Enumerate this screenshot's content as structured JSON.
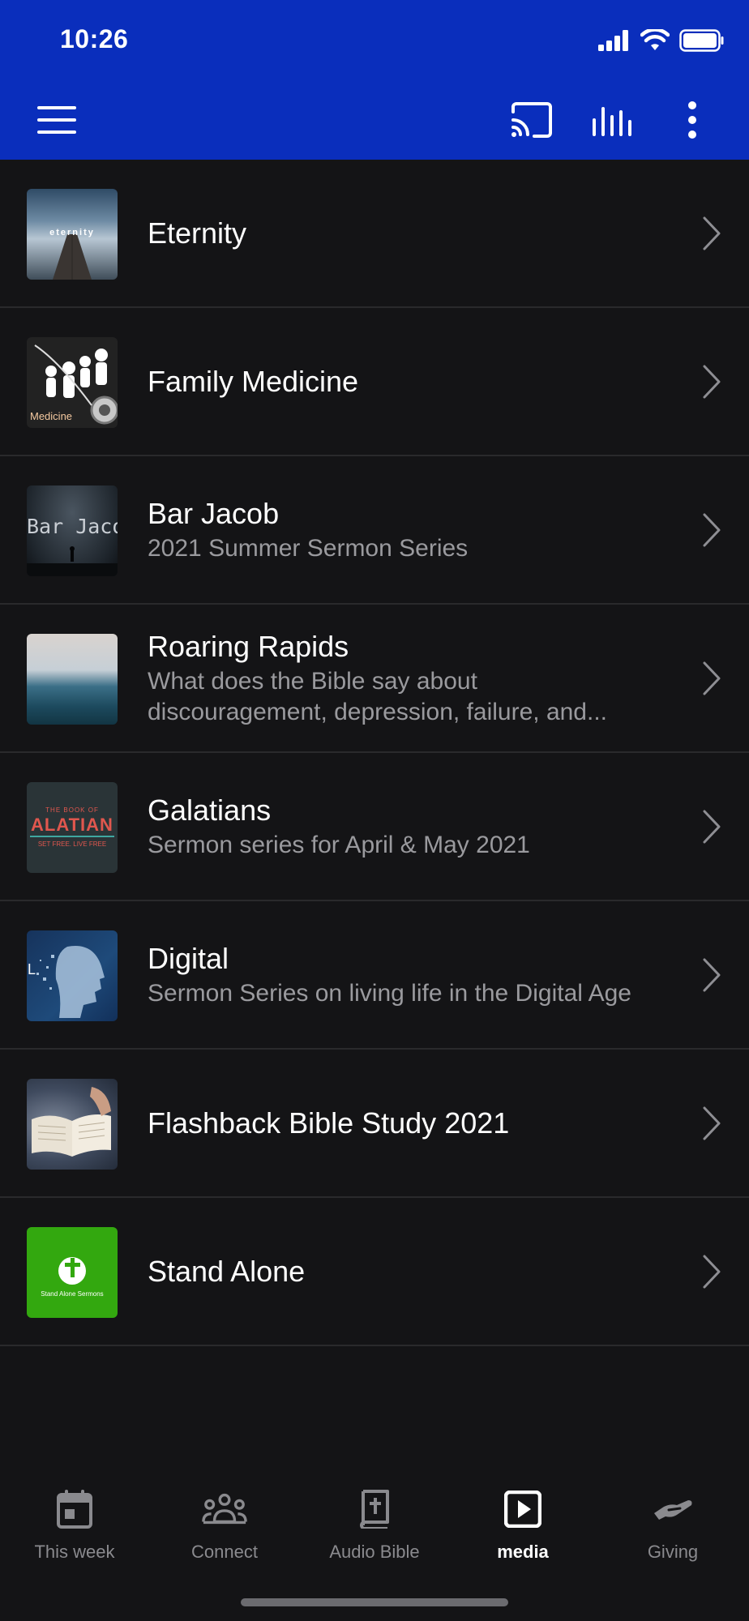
{
  "status": {
    "time": "10:26"
  },
  "colors": {
    "header": "#0a2ebc",
    "background": "#141416",
    "subtitle": "#9a9a9e",
    "accent_green": "#33a80f"
  },
  "toolbar": {
    "menu_icon": "hamburger-icon",
    "cast_icon": "cast-icon",
    "equalizer_icon": "equalizer-icon",
    "more_icon": "more-vertical-icon"
  },
  "items": [
    {
      "title": "Eternity",
      "subtitle": "",
      "thumb_text": "eternity"
    },
    {
      "title": "Family Medicine",
      "subtitle": "",
      "thumb_text": "Medicine"
    },
    {
      "title": "Bar Jacob",
      "subtitle": "2021 Summer Sermon Series",
      "thumb_text": "Bar Jacob"
    },
    {
      "title": "Roaring Rapids",
      "subtitle": "What does the Bible say about discouragement, depression, failure, and...",
      "thumb_text": ""
    },
    {
      "title": "Galatians",
      "subtitle": "Sermon series for April & May 2021",
      "thumb_text": "THE BOOK OF",
      "thumb_text2": "ALATIAN",
      "thumb_text3": "SET FREE. LIVE FREE"
    },
    {
      "title": "Digital",
      "subtitle": "Sermon Series on living life in the Digital Age",
      "thumb_text": "L"
    },
    {
      "title": "Flashback Bible Study 2021",
      "subtitle": "",
      "thumb_text": ""
    },
    {
      "title": "Stand Alone",
      "subtitle": "",
      "thumb_text": "Stand Alone Sermons"
    }
  ],
  "nav": [
    {
      "label": "This week",
      "icon": "calendar-icon",
      "active": false
    },
    {
      "label": "Connect",
      "icon": "people-icon",
      "active": false
    },
    {
      "label": "Audio Bible",
      "icon": "bible-icon",
      "active": false
    },
    {
      "label": "media",
      "icon": "play-icon",
      "active": true
    },
    {
      "label": "Giving",
      "icon": "giving-hand-icon",
      "active": false
    }
  ]
}
